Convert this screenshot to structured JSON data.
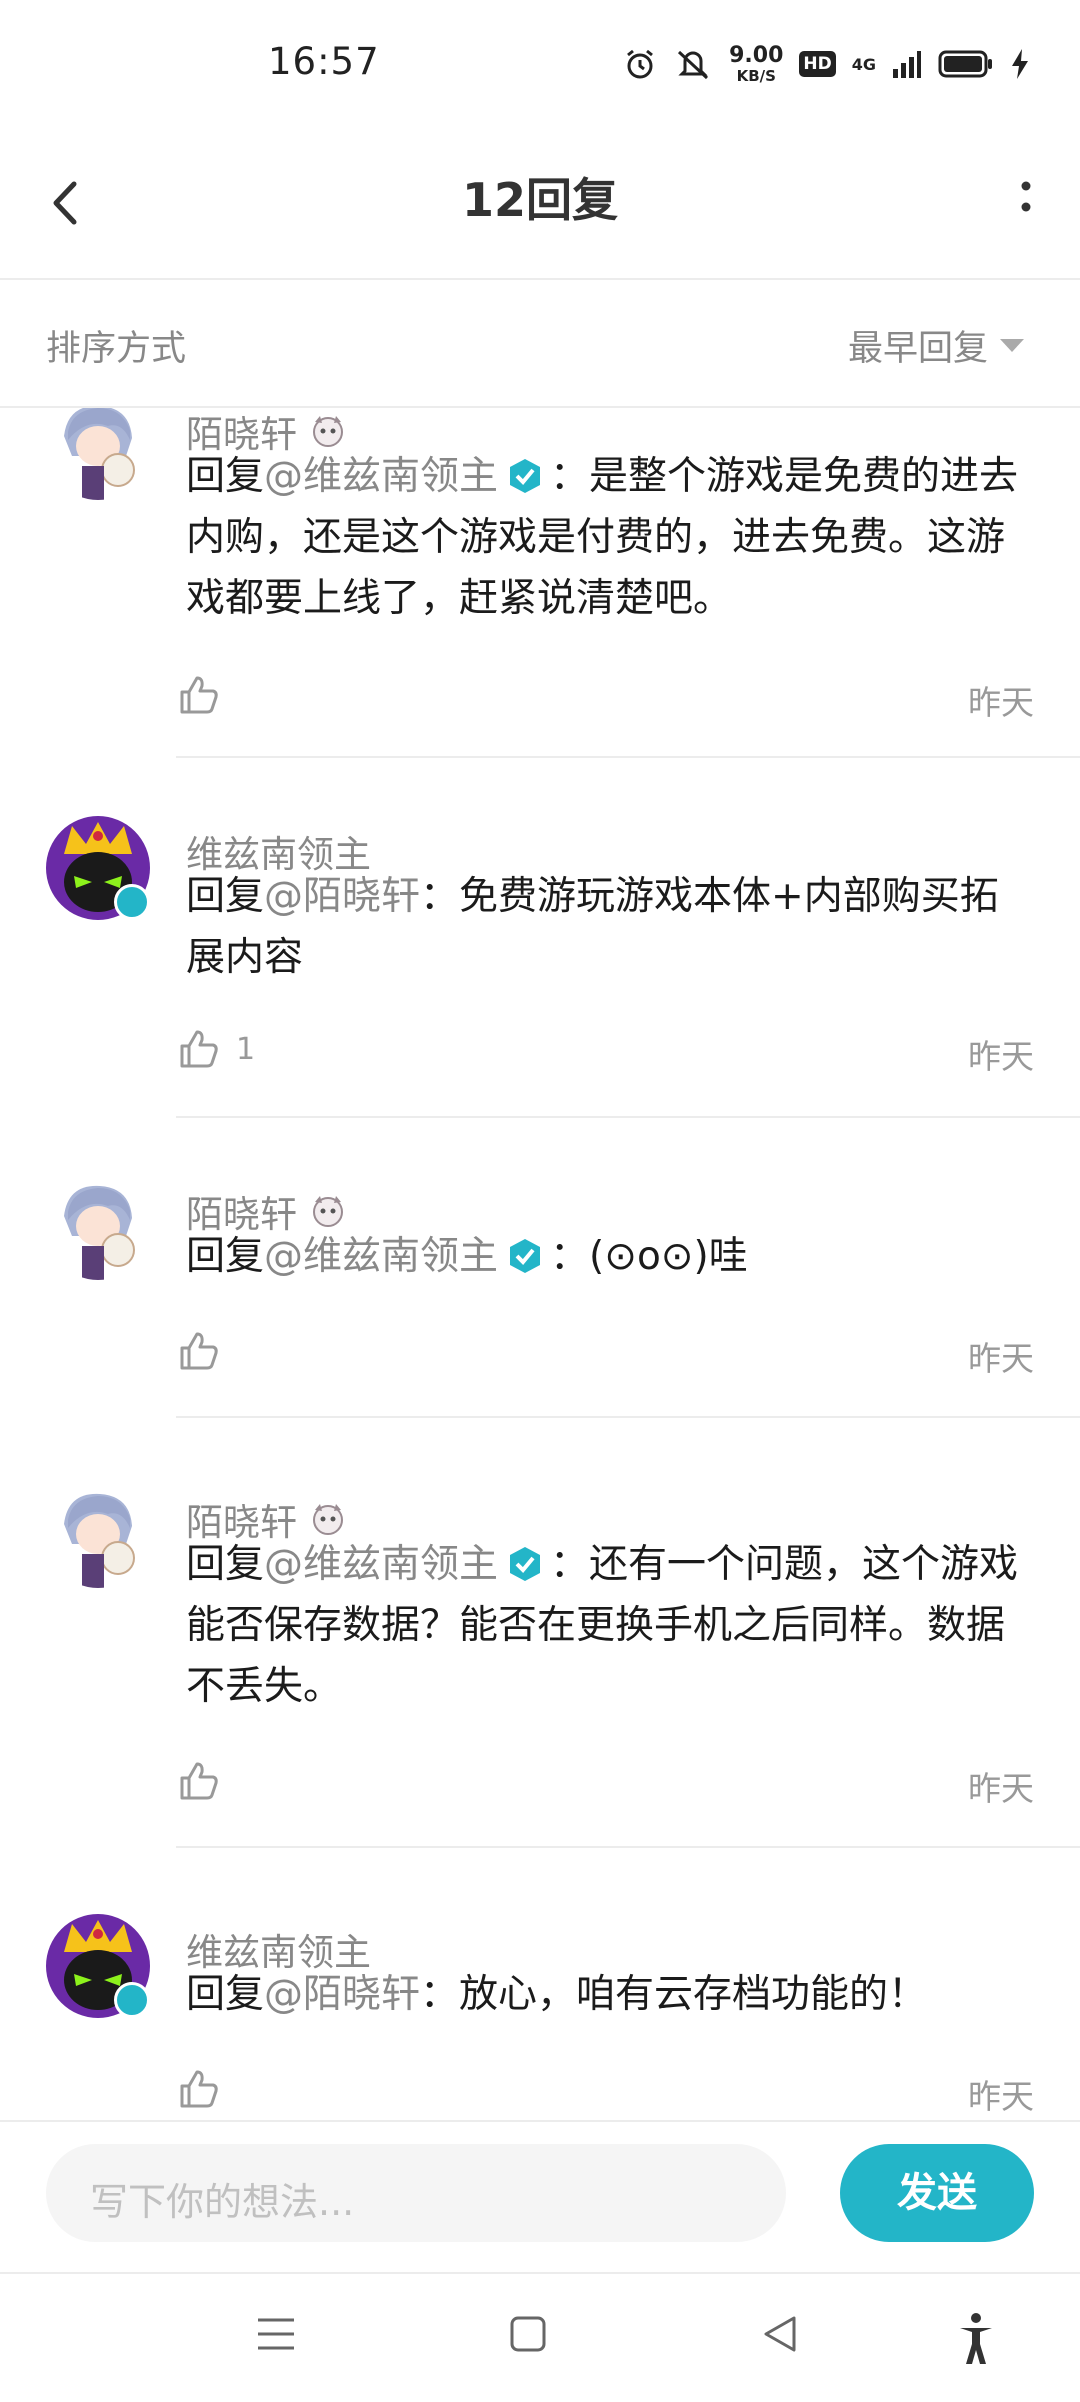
{
  "status_bar": {
    "time": "16:57",
    "net_speed_value": "9.00",
    "net_speed_unit": "KB/S",
    "hd_label": "HD",
    "signal_label": "4G",
    "icons": [
      "alarm-icon",
      "mute-icon",
      "signal-icon",
      "battery-icon",
      "charging-icon"
    ]
  },
  "header": {
    "title": "12回复",
    "back_icon": "chevron-left-icon",
    "more_icon": "more-vertical-icon"
  },
  "sort": {
    "label": "排序方式",
    "value": "最早回复"
  },
  "comments": [
    {
      "author": "陌晓轩",
      "prefix": "回复",
      "mention": "@维兹南领主",
      "mention_verified": true,
      "sep": "：",
      "text": "是整个游戏是免费的进去内购，还是这个游戏是付费的，进去免费。这游戏都要上线了，赶紧说清楚吧。",
      "likes": "",
      "time": "昨天"
    },
    {
      "author": "维兹南领主",
      "prefix": "回复",
      "mention": "@陌晓轩",
      "mention_verified": false,
      "sep": "：",
      "text": "免费游玩游戏本体+内部购买拓展内容",
      "likes": "1",
      "time": "昨天"
    },
    {
      "author": "陌晓轩",
      "prefix": "回复",
      "mention": "@维兹南领主",
      "mention_verified": true,
      "sep": "：",
      "text": "(⊙o⊙)哇",
      "likes": "",
      "time": "昨天"
    },
    {
      "author": "陌晓轩",
      "prefix": "回复",
      "mention": "@维兹南领主",
      "mention_verified": true,
      "sep": "：",
      "text": "还有一个问题，这个游戏能否保存数据？能否在更换手机之后同样。数据不丢失。",
      "likes": "",
      "time": "昨天"
    },
    {
      "author": "维兹南领主",
      "prefix": "回复",
      "mention": "@陌晓轩",
      "mention_verified": false,
      "sep": "：",
      "text": "放心，咱有云存档功能的！",
      "likes": "",
      "time": "昨天"
    }
  ],
  "input": {
    "placeholder": "写下你的想法...",
    "send_label": "发送"
  },
  "colors": {
    "accent": "#23b5c8",
    "muted_text": "#888888",
    "divider": "#ececec"
  },
  "nav_icons": [
    "menu-icon",
    "home-square-icon",
    "back-triangle-icon",
    "accessibility-icon"
  ]
}
